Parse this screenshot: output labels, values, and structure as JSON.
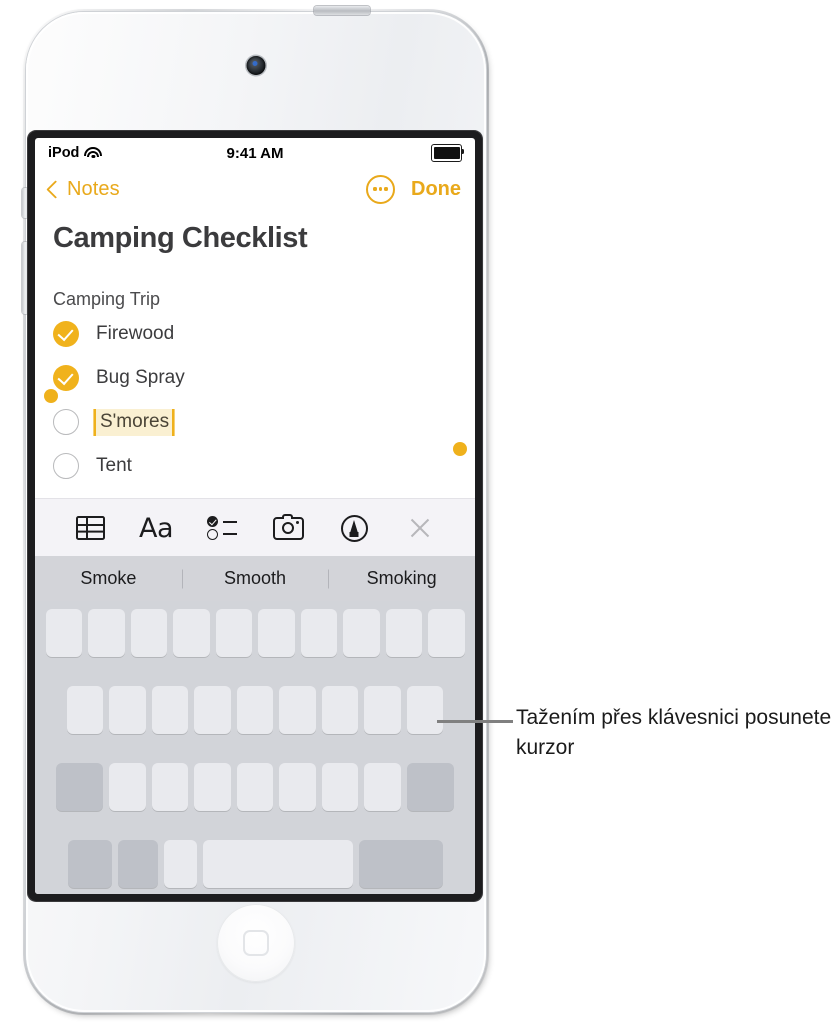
{
  "device": {
    "name": "iPod touch",
    "camera": "front-camera",
    "home_button": "home-button"
  },
  "status_bar": {
    "carrier": "iPod",
    "wifi": "wifi-icon",
    "time": "9:41 AM",
    "battery": "battery-full-icon"
  },
  "nav_bar": {
    "back_label": "Notes",
    "more_label": "more-button",
    "done_label": "Done",
    "accent_color": "#E9A91B"
  },
  "note": {
    "title": "Camping Checklist",
    "subtitle": "Camping Trip",
    "items": [
      {
        "label": "Firewood",
        "checked": true,
        "selected": false
      },
      {
        "label": "Bug Spray",
        "checked": true,
        "selected": false
      },
      {
        "label": "S'mores",
        "checked": false,
        "selected": true
      },
      {
        "label": "Tent",
        "checked": false,
        "selected": false
      }
    ],
    "selection_color": "#EFB11C",
    "selection_highlight": "#FAF0D2"
  },
  "toolbar": {
    "items": [
      {
        "name": "table-icon",
        "label": "Table"
      },
      {
        "name": "format-icon",
        "label": "Aa"
      },
      {
        "name": "checklist-icon",
        "label": "Checklist"
      },
      {
        "name": "camera-icon",
        "label": "Camera"
      },
      {
        "name": "markup-icon",
        "label": "Markup"
      },
      {
        "name": "close-icon",
        "label": "Close"
      }
    ]
  },
  "predictive_bar": {
    "suggestions": [
      "Smoke",
      "Smooth",
      "Smoking"
    ]
  },
  "keyboard": {
    "rows": [
      {
        "keys": 10,
        "variant": "letters"
      },
      {
        "keys": 9,
        "variant": "letters"
      },
      {
        "keys": 9,
        "variant": "shift-letters-delete"
      },
      {
        "keys": 5,
        "variant": "bottom"
      }
    ]
  },
  "callout": {
    "text": "Tažením přes klávesnici posunete kurzor"
  }
}
